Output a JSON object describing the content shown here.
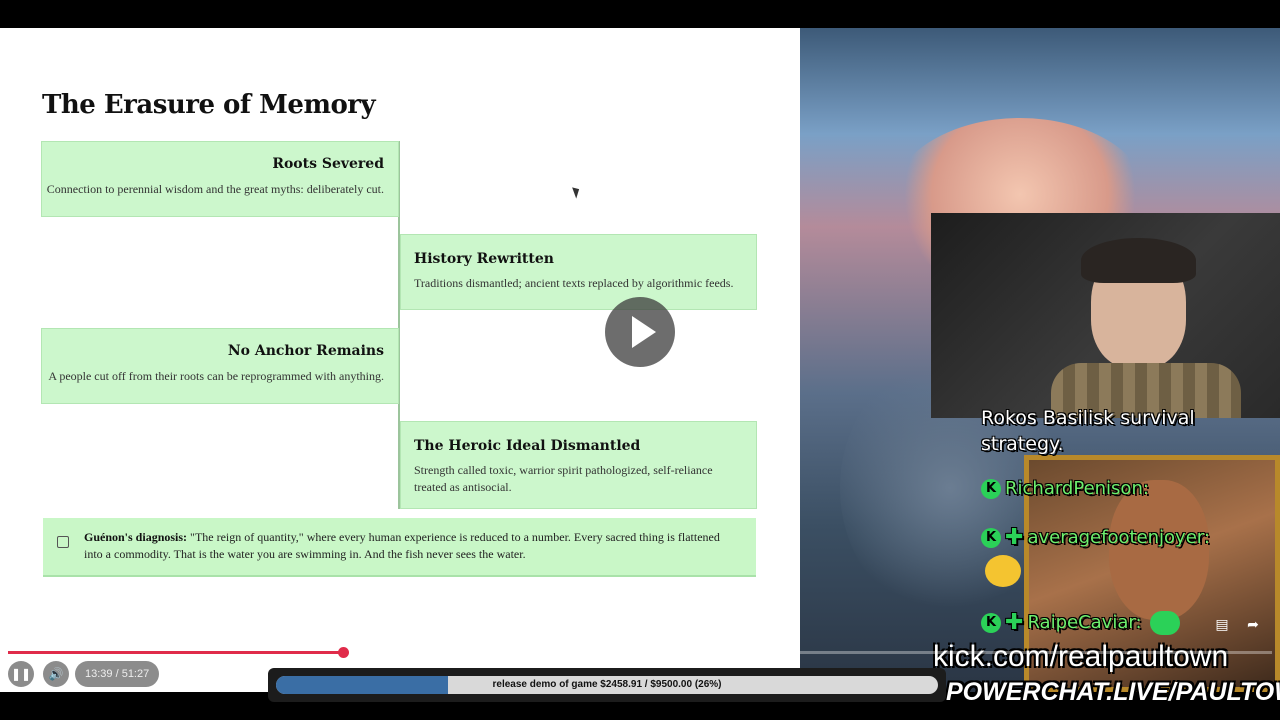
{
  "slide": {
    "title": "The Erasure of Memory",
    "cards": [
      {
        "title": "Roots Severed",
        "text": "Connection to perennial wisdom and the great myths: deliberately cut."
      },
      {
        "title": "History Rewritten",
        "text": "Traditions dismantled; ancient texts replaced by algorithmic feeds."
      },
      {
        "title": "No Anchor Remains",
        "text": "A people cut off from their roots can be reprogrammed with anything."
      },
      {
        "title": "The Heroic Ideal Dismantled",
        "text": "Strength called toxic, warrior spirit pathologized, self-reliance treated as antisocial."
      }
    ],
    "note": {
      "label": "Guénon's diagnosis:",
      "text": " \"The reign of quantity,\" where every human experience is reduced to a number. Every sacred thing is flattened into a commodity. That is the water you are swimming in. And the fish never sees the water."
    }
  },
  "stream": {
    "chat_prev": "Rokos Basilisk survival strategy.",
    "chat": [
      {
        "user": "RichardPenison:",
        "badges": [
          "kick-badge"
        ]
      },
      {
        "user": "averagefootenjoyer:",
        "badges": [
          "kick-badge",
          "plus-badge"
        ]
      },
      {
        "user": "RaipeCaviar:",
        "badges": [
          "kick-badge",
          "plus-badge"
        ]
      }
    ],
    "kick_url": "kick.com/realpaultown",
    "powerchat": "POWERCHAT.LIVE/PAULTOWN"
  },
  "player": {
    "time": "13:39 / 51:27",
    "progress": 0.265,
    "accent": "#e02b4a"
  },
  "goal": {
    "text": "release demo of game $2458.91 / $9500.00 (26%)",
    "progress": 0.26,
    "fill_color": "#3a6ea5"
  }
}
